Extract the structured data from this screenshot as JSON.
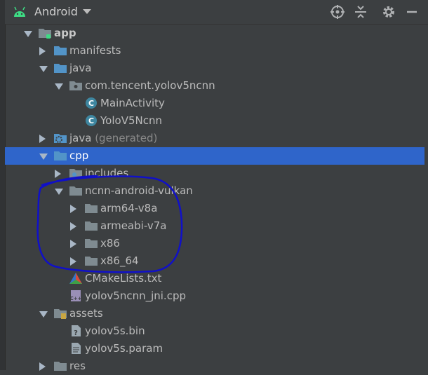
{
  "toolbar": {
    "title": "Android"
  },
  "tree": [
    {
      "label": "app",
      "bold": true,
      "arrow": "expanded",
      "icon": "module-folder-icon"
    },
    {
      "label": "manifests",
      "arrow": "collapsed",
      "icon": "folder-icon"
    },
    {
      "label": "java",
      "arrow": "expanded",
      "icon": "folder-icon"
    },
    {
      "label": "com.tencent.yolov5ncnn",
      "arrow": "expanded",
      "icon": "package-icon"
    },
    {
      "label": "MainActivity",
      "arrow": "none",
      "icon": "class-icon"
    },
    {
      "label": "YoloV5Ncnn",
      "arrow": "none",
      "icon": "class-icon"
    },
    {
      "label": "java",
      "suffix": "(generated)",
      "arrow": "collapsed",
      "icon": "generated-folder-icon"
    },
    {
      "label": "cpp",
      "arrow": "expanded",
      "icon": "folder-icon",
      "selected": true
    },
    {
      "label": "includes",
      "arrow": "collapsed",
      "icon": "includes-folder-icon"
    },
    {
      "label": "ncnn-android-vulkan",
      "arrow": "expanded",
      "icon": "folder-gray-icon"
    },
    {
      "label": "arm64-v8a",
      "arrow": "collapsed",
      "icon": "folder-gray-icon"
    },
    {
      "label": "armeabi-v7a",
      "arrow": "collapsed",
      "icon": "folder-gray-icon"
    },
    {
      "label": "x86",
      "arrow": "collapsed",
      "icon": "folder-gray-icon"
    },
    {
      "label": "x86_64",
      "arrow": "collapsed",
      "icon": "folder-gray-icon"
    },
    {
      "label": "CMakeLists.txt",
      "arrow": "none",
      "icon": "cmake-icon"
    },
    {
      "label": "yolov5ncnn_jni.cpp",
      "arrow": "none",
      "icon": "cpp-file-icon"
    },
    {
      "label": "assets",
      "arrow": "expanded",
      "icon": "assets-folder-icon"
    },
    {
      "label": "yolov5s.bin",
      "arrow": "none",
      "icon": "unknown-file-icon"
    },
    {
      "label": "yolov5s.param",
      "arrow": "none",
      "icon": "text-file-icon"
    },
    {
      "label": "res",
      "arrow": "collapsed",
      "icon": "folder-gray-icon"
    }
  ],
  "colors": {
    "background": "#3c3f41",
    "selection": "#2f65ca",
    "annotation": "#1010c8",
    "folder_blue": "#5294c8",
    "folder_gray": "#7f8b91"
  }
}
